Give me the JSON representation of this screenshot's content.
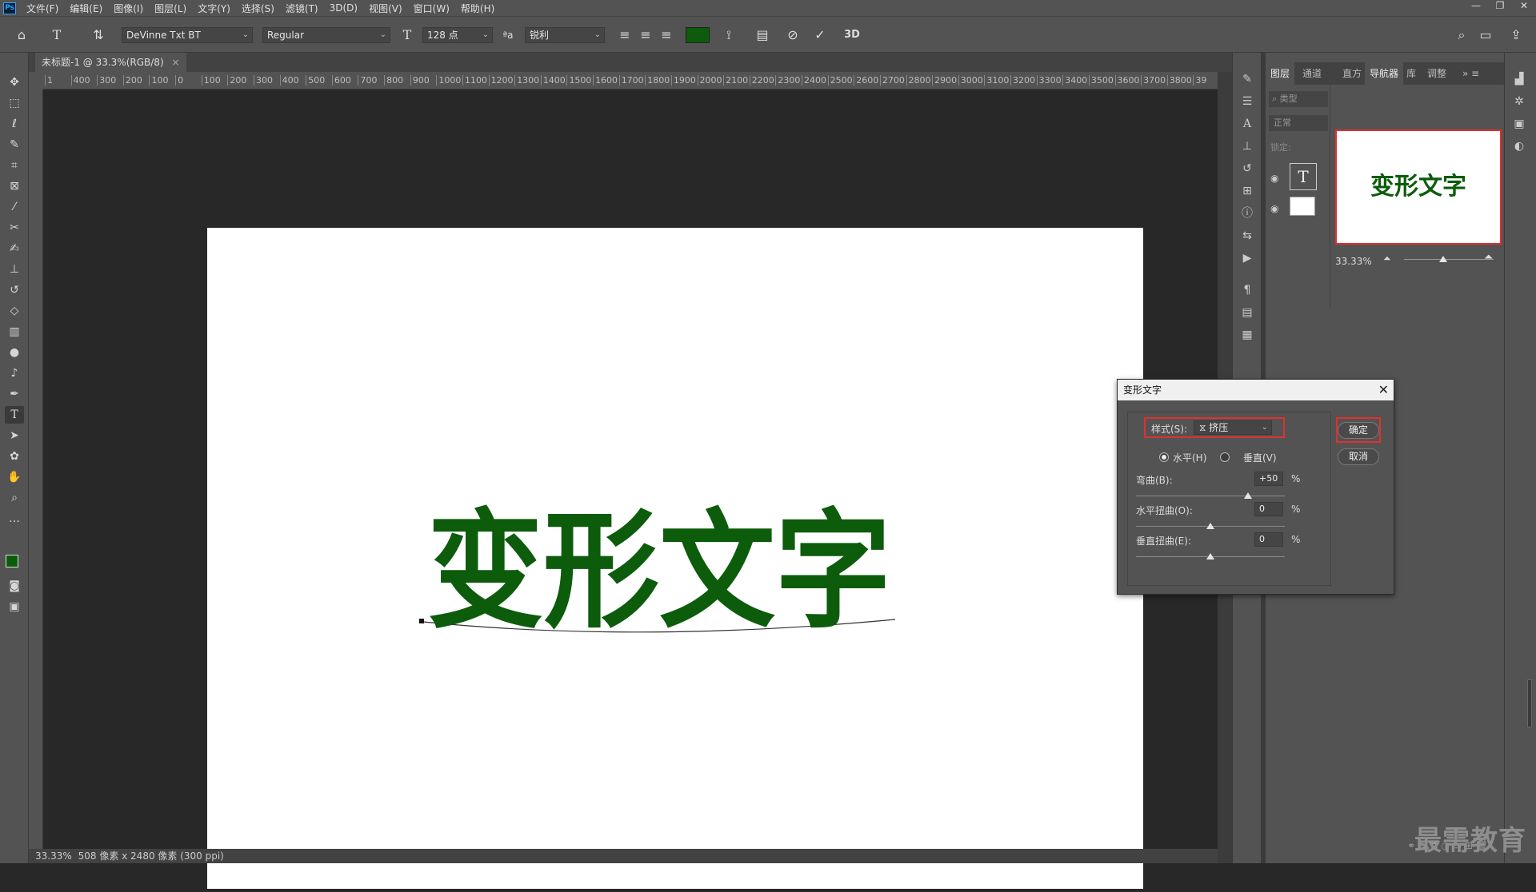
{
  "app": {
    "logo": "Ps",
    "window_controls": [
      "—",
      "❐",
      "✕"
    ]
  },
  "menu": [
    "文件(F)",
    "编辑(E)",
    "图像(I)",
    "图层(L)",
    "文字(Y)",
    "选择(S)",
    "滤镜(T)",
    "3D(D)",
    "视图(V)",
    "窗口(W)",
    "帮助(H)"
  ],
  "options": {
    "font_family": "DeVinne Txt BT",
    "font_style": "Regular",
    "font_size": "128 点",
    "aa_label": "ªa",
    "antialias": "锐利",
    "text_color": "#0c5c0c",
    "btn_3d": "3D"
  },
  "document": {
    "tab_title": "未标题-1 @ 33.3%(RGB/8)",
    "canvas_text": "变形文字",
    "text_color": "#0c5c0c",
    "status": "33.33%",
    "status_info": "508 像素 x 2480 像素 (300 ppi)"
  },
  "ruler": {
    "marks": [
      "1",
      "400",
      "300",
      "200",
      "100",
      "0",
      "100",
      "200",
      "300",
      "400",
      "500",
      "600",
      "700",
      "800",
      "900",
      "1000",
      "1100",
      "1200",
      "1300",
      "1400",
      "1500",
      "1600",
      "1700",
      "1800",
      "1900",
      "2000",
      "2100",
      "2200",
      "2300",
      "2400",
      "2500",
      "2600",
      "2700",
      "2800",
      "2900",
      "3000",
      "3100",
      "3200",
      "3300",
      "3400",
      "3500",
      "3600",
      "3700",
      "3800",
      "39"
    ]
  },
  "panels": {
    "left_group_tabs": [
      "图层",
      "通道"
    ],
    "right_group_tabs": [
      "直方",
      "导航器",
      "库",
      "调整"
    ],
    "layer_search": "类型",
    "blend_mode": "正常",
    "lock_label": "锁定:",
    "navigator_zoom": "33.33%",
    "navigator_preview_text": "变形文字"
  },
  "dialog": {
    "title": "变形文字",
    "style_label": "样式(S):",
    "style_value": "挤压",
    "horizontal_label": "水平(H)",
    "vertical_label": "垂直(V)",
    "orientation": "horizontal",
    "bend_label": "弯曲(B):",
    "bend_value": "+50",
    "hdist_label": "水平扭曲(O):",
    "hdist_value": "0",
    "vdist_label": "垂直扭曲(E):",
    "vdist_value": "0",
    "percent": "%",
    "ok_label": "确定",
    "cancel_label": "取消",
    "bend": 50,
    "hdist": 0,
    "vdist": 0
  },
  "watermark": "最需教育"
}
